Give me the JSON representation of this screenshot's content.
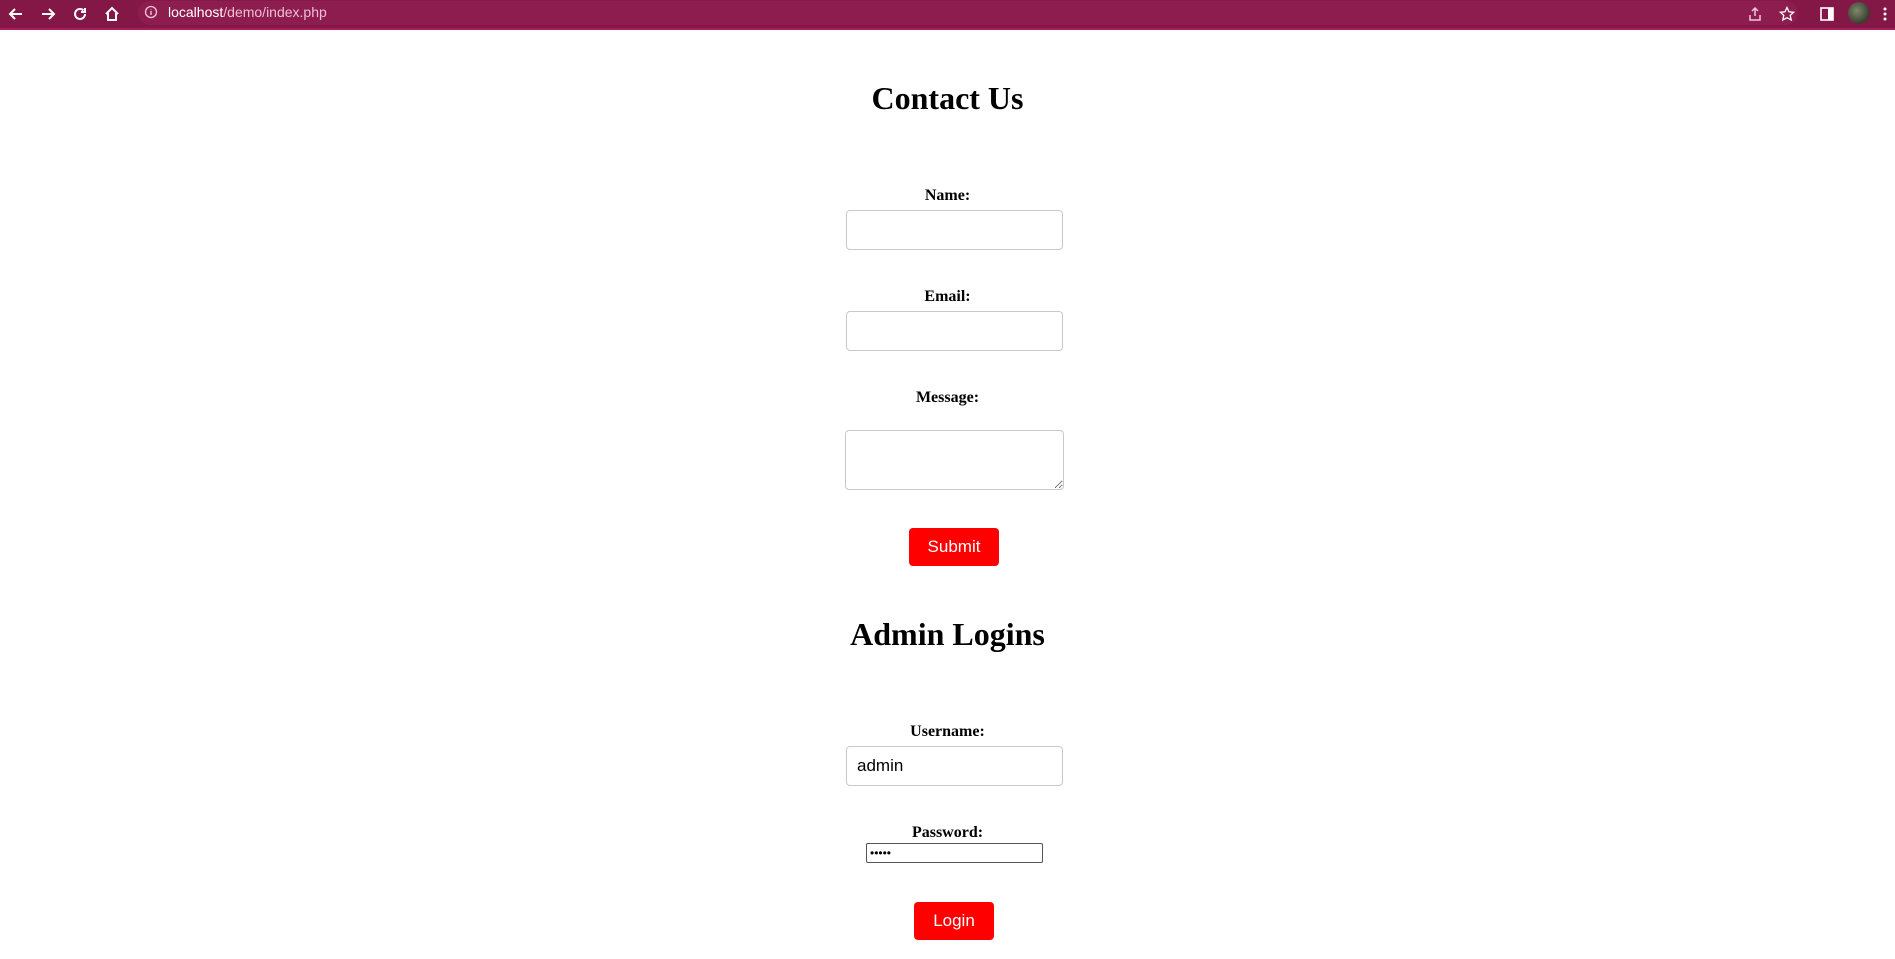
{
  "browser": {
    "url_host": "localhost",
    "url_path": "/demo/index.php"
  },
  "contact": {
    "title": "Contact Us",
    "name_label": "Name:",
    "name_value": "",
    "email_label": "Email:",
    "email_value": "",
    "message_label": "Message:",
    "message_value": "",
    "submit_label": "Submit"
  },
  "admin": {
    "title": "Admin Logins",
    "username_label": "Username:",
    "username_value": "admin",
    "password_label": "Password:",
    "password_value": "•••••",
    "login_label": "Login"
  },
  "colors": {
    "toolbar": "#831846",
    "button": "#fe0000"
  },
  "icons": [
    "back-icon",
    "forward-icon",
    "reload-icon",
    "home-icon",
    "info-icon",
    "share-icon",
    "star-icon",
    "side-panel-icon",
    "menu-icon"
  ]
}
